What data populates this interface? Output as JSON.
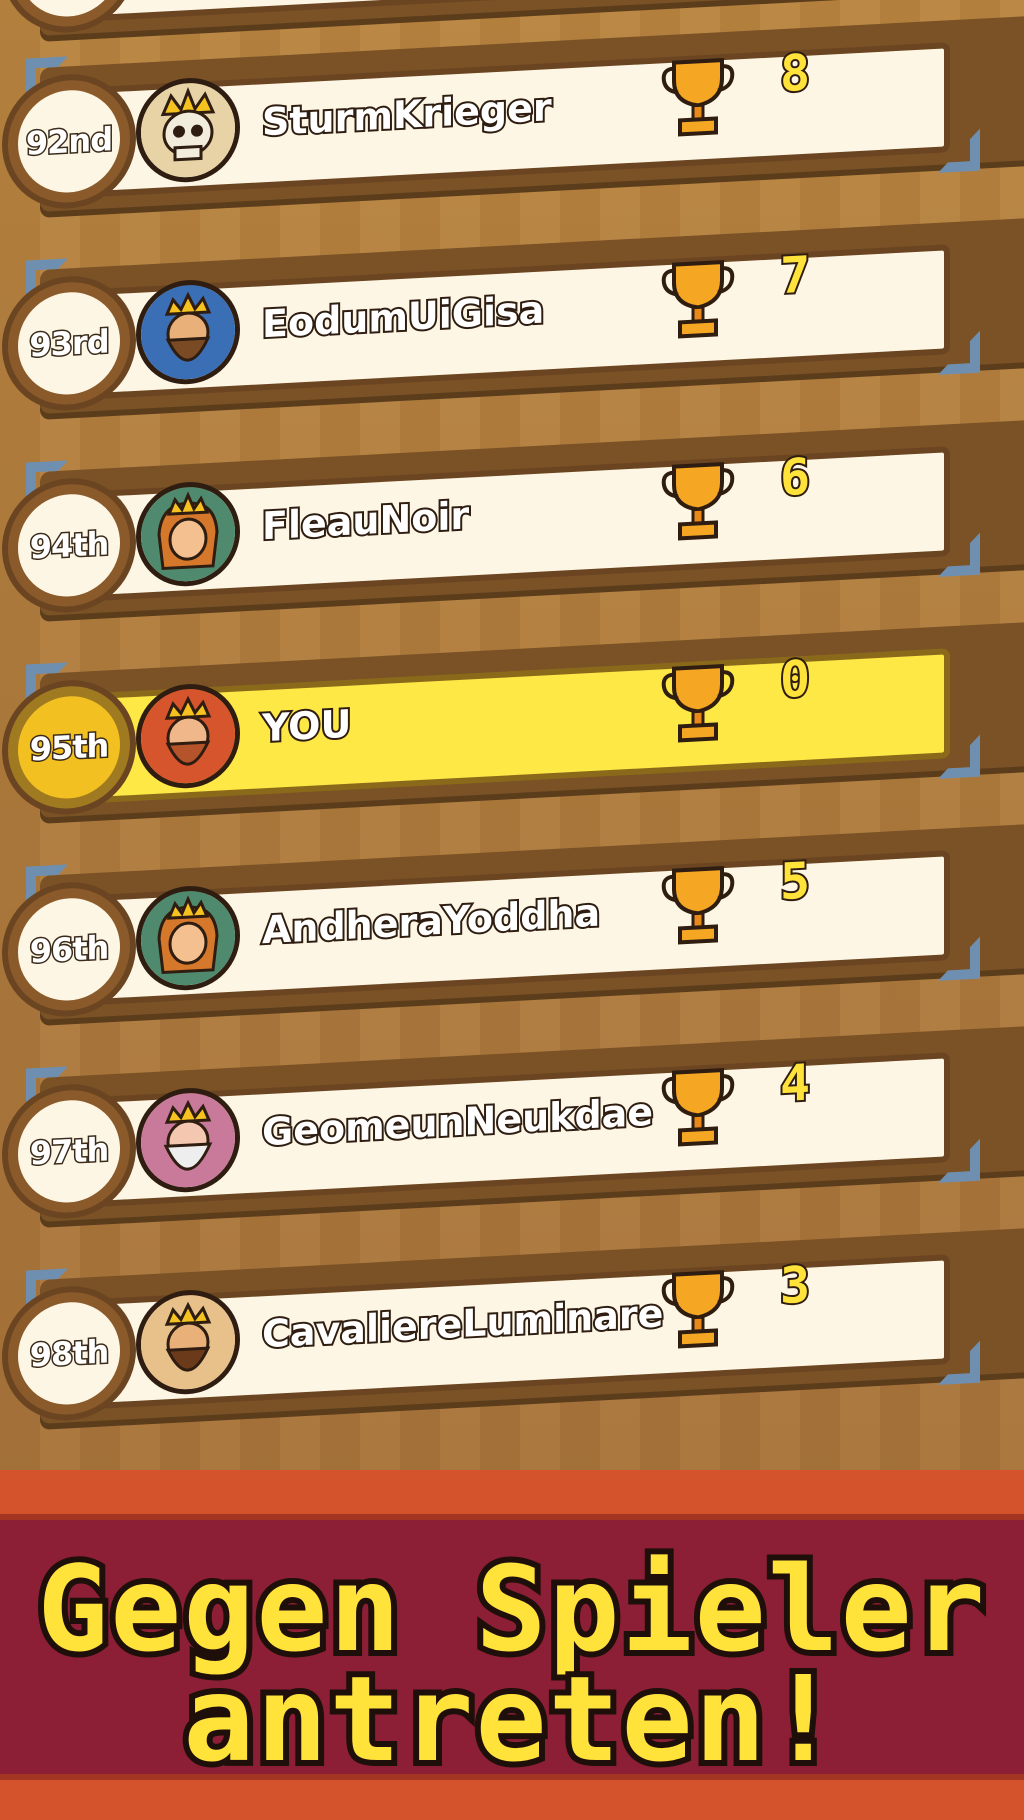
{
  "leaderboard": {
    "rows": [
      {
        "rank": "92nd",
        "name": "SturmKrieger",
        "trophies": "8",
        "avatar": "skeleton-king-avatar",
        "is_player": false
      },
      {
        "rank": "93rd",
        "name": "EodumUiGisa",
        "trophies": "7",
        "avatar": "bearded-king-avatar",
        "is_player": false
      },
      {
        "rank": "94th",
        "name": "FleauNoir",
        "trophies": "6",
        "avatar": "elf-queen-avatar",
        "is_player": false
      },
      {
        "rank": "95th",
        "name": "YOU",
        "trophies": "0",
        "avatar": "redbeard-king-avatar",
        "is_player": true
      },
      {
        "rank": "96th",
        "name": "AndheraYoddha",
        "trophies": "5",
        "avatar": "elf-queen-avatar",
        "is_player": false
      },
      {
        "rank": "97th",
        "name": "GeomeunNeukdae",
        "trophies": "4",
        "avatar": "old-king-avatar",
        "is_player": false
      },
      {
        "rank": "98th",
        "name": "CavaliereLuminare",
        "trophies": "3",
        "avatar": "dwarf-king-avatar",
        "is_player": false
      }
    ]
  },
  "banner": {
    "line1": "Gegen Spieler",
    "line2": "antreten!"
  },
  "colors": {
    "card": "#fdf6e4",
    "highlight": "#fde845",
    "score": "#ffe23a",
    "banner_bg": "#8c1f35",
    "banner_trim": "#d4532c"
  }
}
